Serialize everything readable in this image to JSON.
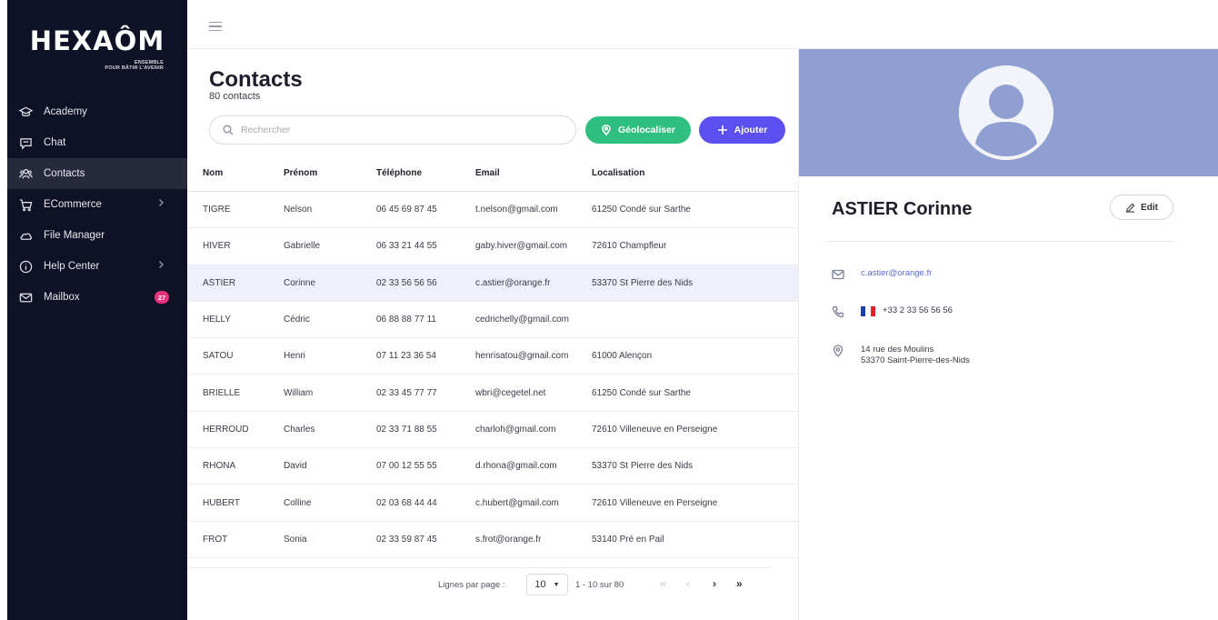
{
  "brand": {
    "logo_text": "HEXAÔM",
    "tagline_1": "ENSEMBLE",
    "tagline_2": "POUR BÂTIR L'AVENIR"
  },
  "sidebar": {
    "items": [
      {
        "label": "Academy",
        "icon": "graduation-cap-icon"
      },
      {
        "label": "Chat",
        "icon": "chat-bubble-icon"
      },
      {
        "label": "Contacts",
        "icon": "contacts-icon",
        "active": true
      },
      {
        "label": "ECommerce",
        "icon": "cart-icon",
        "has_submenu": true
      },
      {
        "label": "File Manager",
        "icon": "cloud-icon"
      },
      {
        "label": "Help Center",
        "icon": "info-icon",
        "has_submenu": true
      },
      {
        "label": "Mailbox",
        "icon": "mail-icon",
        "badge": "27"
      }
    ]
  },
  "contacts": {
    "title": "Contacts",
    "count_label": "80 contacts",
    "search_placeholder": "Rechercher",
    "geolocate_label": "Géolocaliser",
    "add_label": "Ajouter",
    "columns": [
      "Nom",
      "Prénom",
      "Téléphone",
      "Email",
      "Localisation"
    ],
    "rows": [
      [
        "TIGRE",
        "Nelson",
        "06 45 69 87 45",
        "t.nelson@gmail.com",
        "61250 Condé sur Sarthe"
      ],
      [
        "HIVER",
        "Gabrielle",
        "06 33 21 44 55",
        "gaby.hiver@gmail.com",
        "72610 Champfleur"
      ],
      [
        "ASTIER",
        "Corinne",
        "02 33 56 56 56",
        "c.astier@orange.fr",
        "53370 St Pierre des Nids"
      ],
      [
        "HELLY",
        "Cédric",
        "06 88 88 77 11",
        "cedrichelly@gmail.com",
        ""
      ],
      [
        "SATOU",
        "Henri",
        "07 11 23 36 54",
        "henrisatou@gmail.com",
        "61000 Alençon"
      ],
      [
        "BRIELLE",
        "William",
        "02 33 45 77 77",
        "wbri@cegetel.net",
        "61250 Condé sur Sarthe"
      ],
      [
        "HERROUD",
        "Charles",
        "02 33 71 88 55",
        "charloh@gmail.com",
        "72610 Villeneuve en Perseigne"
      ],
      [
        "RHONA",
        "David",
        "07 00 12 55 55",
        "d.rhona@gmail.com",
        "53370 St Pierre des Nids"
      ],
      [
        "HUBERT",
        "Colline",
        "02 03 68 44 44",
        "c.hubert@gmail.com",
        "72610 Villeneuve en Perseigne"
      ],
      [
        "FROT",
        "Sonia",
        "02 33 59 87 45",
        "s.frot@orange.fr",
        "53140 Pré en Pail"
      ]
    ],
    "selected_row": 2,
    "pagination": {
      "rows_per_page_label": "Lignes par page :",
      "rows_per_page": "10",
      "range": "1 - 10 sur 80",
      "first": "«",
      "prev": "‹",
      "next": "›",
      "last": "»"
    }
  },
  "detail": {
    "name": "ASTIER Corinne",
    "edit_label": "Edit",
    "email": "c.astier@orange.fr",
    "phone": "+33 2 33 56 56 56",
    "address_line1": "14 rue des Moulins",
    "address_line2": "53370 Saint-Pierre-des-Nids",
    "cover_color": "#8f9fd1",
    "flag_colors": [
      "#1f3fa8",
      "#ffffff",
      "#e2232b"
    ]
  },
  "colors": {
    "sidebar_bg": "#0f1226",
    "accent": "#5b4ff0",
    "success": "#2fbf7f",
    "badge": "#e8317a"
  }
}
